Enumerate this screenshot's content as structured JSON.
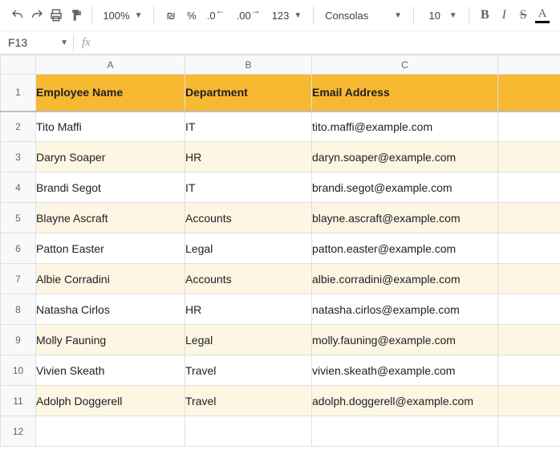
{
  "toolbar": {
    "zoom": "100%",
    "currency_symbol": "₪",
    "percent": "%",
    "dec_dec": ".0",
    "dec_inc": ".00",
    "more_formats": "123",
    "font_name": "Consolas",
    "font_size": "10",
    "bold": "B",
    "italic": "I",
    "strike": "S",
    "textcolor": "A"
  },
  "namebox": {
    "ref": "F13",
    "fx_label": "fx"
  },
  "columns": [
    "A",
    "B",
    "C"
  ],
  "headers": {
    "name": "Employee Name",
    "dept": "Department",
    "email": "Email Address"
  },
  "rows": [
    {
      "n": "2",
      "name": "Tito Maffi",
      "dept": "IT",
      "email": "tito.maffi@example.com"
    },
    {
      "n": "3",
      "name": "Daryn Soaper",
      "dept": "HR",
      "email": "daryn.soaper@example.com"
    },
    {
      "n": "4",
      "name": "Brandi Segot",
      "dept": "IT",
      "email": "brandi.segot@example.com"
    },
    {
      "n": "5",
      "name": "Blayne Ascraft",
      "dept": "Accounts",
      "email": "blayne.ascraft@example.com"
    },
    {
      "n": "6",
      "name": "Patton Easter",
      "dept": "Legal",
      "email": "patton.easter@example.com"
    },
    {
      "n": "7",
      "name": "Albie Corradini",
      "dept": "Accounts",
      "email": "albie.corradini@example.com"
    },
    {
      "n": "8",
      "name": "Natasha Cirlos",
      "dept": "HR",
      "email": "natasha.cirlos@example.com"
    },
    {
      "n": "9",
      "name": "Molly Fauning",
      "dept": "Legal",
      "email": "molly.fauning@example.com"
    },
    {
      "n": "10",
      "name": "Vivien Skeath",
      "dept": "Travel",
      "email": "vivien.skeath@example.com"
    },
    {
      "n": "11",
      "name": "Adolph Doggerell",
      "dept": "Travel",
      "email": "adolph.doggerell@example.com"
    }
  ],
  "empty_row": "12"
}
